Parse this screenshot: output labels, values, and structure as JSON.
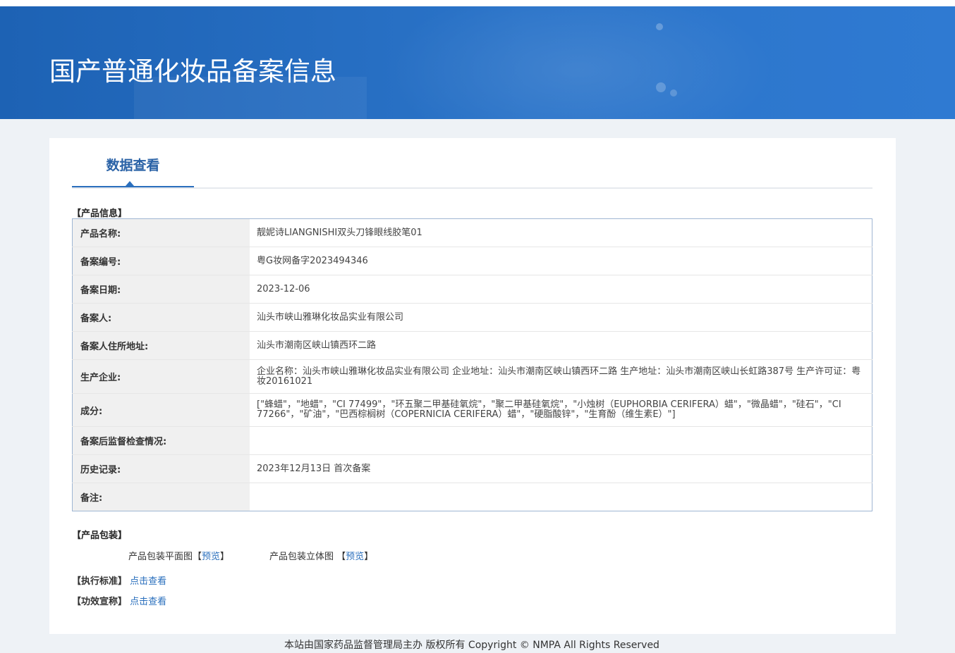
{
  "header": {
    "title": "国产普通化妆品备案信息"
  },
  "tabs": [
    {
      "label": "数据查看",
      "active": true
    }
  ],
  "product_info": {
    "section_label": "【产品信息】",
    "rows": [
      {
        "label": "产品名称:",
        "value": "靓妮诗LIANGNISHI双头刀锋眼线胶笔01"
      },
      {
        "label": "备案编号:",
        "value": "粤G妆网备字2023494346"
      },
      {
        "label": "备案日期:",
        "value": "2023-12-06"
      },
      {
        "label": "备案人:",
        "value": "汕头市峡山雅琳化妆品实业有限公司"
      },
      {
        "label": "备案人住所地址:",
        "value": "汕头市潮南区峡山镇西环二路"
      },
      {
        "label": "生产企业:",
        "value": "企业名称：汕头市峡山雅琳化妆品实业有限公司 企业地址：汕头市潮南区峡山镇西环二路 生产地址：汕头市潮南区峡山长虹路387号 生产许可证：粤妆20161021"
      },
      {
        "label": "成分:",
        "value": "[\"蜂蜡\"，\"地蜡\"，\"CI 77499\"，\"环五聚二甲基硅氧烷\"，\"聚二甲基硅氧烷\"，\"小烛树（EUPHORBIA CERIFERA）蜡\"，\"微晶蜡\"，\"硅石\"，\"CI 77266\"，\"矿油\"，\"巴西棕榈树（COPERNICIA CERIFERA）蜡\"，\"硬脂酸锌\"，\"生育酚（维生素E）\"]"
      },
      {
        "label": "备案后监督检查情况:",
        "value": ""
      },
      {
        "label": "历史记录:",
        "value": "2023年12月13日 首次备案"
      },
      {
        "label": "备注:",
        "value": ""
      }
    ]
  },
  "packaging": {
    "section_label": "【产品包装】",
    "flat_label": "产品包装平面图",
    "flat_link": "预览",
    "solid_label": "产品包装立体图",
    "solid_link": "预览",
    "bracket_open": "【",
    "bracket_close": "】"
  },
  "standard": {
    "label": "【执行标准】",
    "link": "点击查看"
  },
  "efficacy": {
    "label": "【功效宣称】",
    "link": "点击查看"
  },
  "footer": {
    "text": "本站由国家药品监督管理局主办 版权所有 Copyright © NMPA All Rights Reserved"
  },
  "colors": {
    "banner": "#2b74c9",
    "accent": "#2a6fbd",
    "page_bg": "#eef2f6"
  }
}
